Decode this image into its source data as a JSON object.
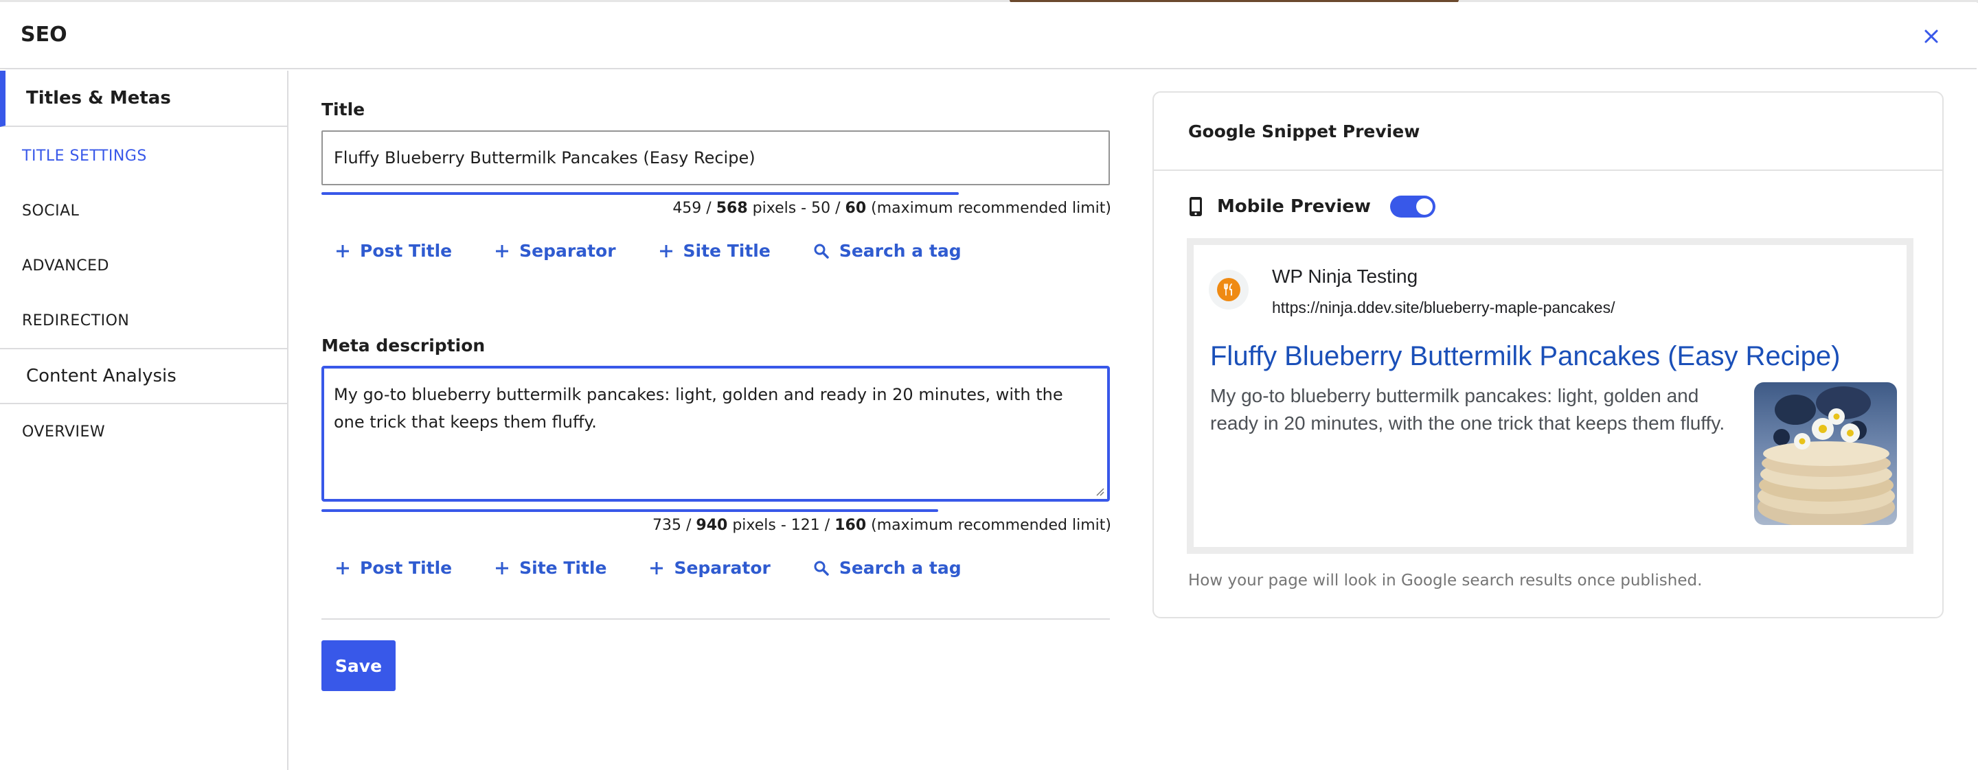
{
  "modal": {
    "title": "SEO"
  },
  "sidebar": {
    "sections": [
      {
        "label": "Titles & Metas",
        "items": [
          "TITLE SETTINGS",
          "SOCIAL",
          "ADVANCED",
          "REDIRECTION"
        ]
      },
      {
        "label": "Content Analysis",
        "items": [
          "OVERVIEW"
        ]
      }
    ],
    "active_item": "TITLE SETTINGS"
  },
  "title_field": {
    "label": "Title",
    "value": "Fluffy Blueberry Buttermilk Pancakes (Easy Recipe)",
    "pixels_used": "459",
    "pixels_max": "568",
    "chars_used": "50",
    "chars_max": "60",
    "limit_note": "(maximum recommended limit)",
    "progress": 0.808,
    "tags": [
      "Post Title",
      "Separator",
      "Site Title",
      "Search a tag"
    ]
  },
  "meta_field": {
    "label": "Meta description",
    "value": "My go-to blueberry buttermilk pancakes: light, golden and ready in 20 minutes, with the one trick that keeps them fluffy.",
    "pixels_used": "735",
    "pixels_max": "940",
    "chars_used": "121",
    "chars_max": "160",
    "limit_note": "(maximum recommended limit)",
    "progress": 0.782,
    "tags": [
      "Post Title",
      "Site Title",
      "Separator",
      "Search a tag"
    ]
  },
  "actions": {
    "save_label": "Save"
  },
  "preview": {
    "heading": "Google Snippet Preview",
    "mobile_label": "Mobile Preview",
    "mobile_enabled": true,
    "site_name": "WP Ninja Testing",
    "url": "https://ninja.ddev.site/blueberry-maple-pancakes/",
    "title": "Fluffy Blueberry Buttermilk Pancakes (Easy Recipe)",
    "description": "My go-to blueberry buttermilk pancakes: light, golden and ready in 20 minutes, with the one trick that keeps them fluffy.",
    "note": "How your page will look in Google search results once published."
  },
  "colors": {
    "accent": "#3858e9",
    "link": "#2f5bd0",
    "favicon": "#ef8a13"
  },
  "icons": {
    "close": "close-icon",
    "add": "plus-icon",
    "search": "search-icon",
    "mobile": "mobile-phone-icon",
    "favicon": "fork-knife-icon"
  }
}
